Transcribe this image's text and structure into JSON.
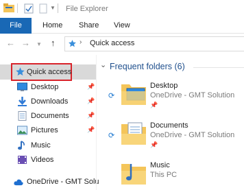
{
  "window": {
    "title": "File Explorer"
  },
  "ribbon": {
    "file_label": "File",
    "tabs": [
      "Home",
      "Share",
      "View"
    ]
  },
  "address": {
    "path": "Quick access",
    "back_icon": "back-arrow-icon",
    "forward_icon": "forward-arrow-icon",
    "up_icon": "up-arrow-icon"
  },
  "sidebar": {
    "items": [
      {
        "label": "Quick access",
        "icon": "star-icon",
        "selected": true
      },
      {
        "label": "Desktop",
        "icon": "desktop-icon",
        "pinned": true
      },
      {
        "label": "Downloads",
        "icon": "download-icon",
        "pinned": true
      },
      {
        "label": "Documents",
        "icon": "documents-icon",
        "pinned": true
      },
      {
        "label": "Pictures",
        "icon": "pictures-icon",
        "pinned": true
      },
      {
        "label": "Music",
        "icon": "music-icon"
      },
      {
        "label": "Videos",
        "icon": "videos-icon"
      },
      {
        "label": "OneDrive - GMT Solu",
        "icon": "cloud-icon"
      }
    ]
  },
  "main": {
    "section_title": "Frequent folders (6)",
    "folders": [
      {
        "name": "Desktop",
        "location": "OneDrive - GMT Solution",
        "synced": true,
        "pinned": true
      },
      {
        "name": "Documents",
        "location": "OneDrive - GMT Solution",
        "synced": true,
        "pinned": true
      },
      {
        "name": "Music",
        "location": "This PC",
        "synced": false,
        "pinned": false
      }
    ]
  },
  "colors": {
    "accent": "#1968b5",
    "highlight_border": "#d9232a",
    "section_heading": "#1e4e8c",
    "folder_yellow": "#f4c55a"
  }
}
